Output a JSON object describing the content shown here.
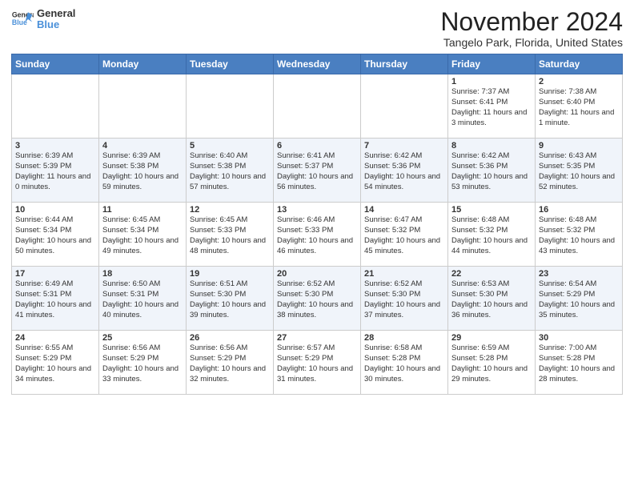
{
  "logo": {
    "line1": "General",
    "line2": "Blue"
  },
  "title": "November 2024",
  "subtitle": "Tangelo Park, Florida, United States",
  "days_of_week": [
    "Sunday",
    "Monday",
    "Tuesday",
    "Wednesday",
    "Thursday",
    "Friday",
    "Saturday"
  ],
  "weeks": [
    [
      {
        "day": "",
        "info": ""
      },
      {
        "day": "",
        "info": ""
      },
      {
        "day": "",
        "info": ""
      },
      {
        "day": "",
        "info": ""
      },
      {
        "day": "",
        "info": ""
      },
      {
        "day": "1",
        "info": "Sunrise: 7:37 AM\nSunset: 6:41 PM\nDaylight: 11 hours and 3 minutes."
      },
      {
        "day": "2",
        "info": "Sunrise: 7:38 AM\nSunset: 6:40 PM\nDaylight: 11 hours and 1 minute."
      }
    ],
    [
      {
        "day": "3",
        "info": "Sunrise: 6:39 AM\nSunset: 5:39 PM\nDaylight: 11 hours and 0 minutes."
      },
      {
        "day": "4",
        "info": "Sunrise: 6:39 AM\nSunset: 5:38 PM\nDaylight: 10 hours and 59 minutes."
      },
      {
        "day": "5",
        "info": "Sunrise: 6:40 AM\nSunset: 5:38 PM\nDaylight: 10 hours and 57 minutes."
      },
      {
        "day": "6",
        "info": "Sunrise: 6:41 AM\nSunset: 5:37 PM\nDaylight: 10 hours and 56 minutes."
      },
      {
        "day": "7",
        "info": "Sunrise: 6:42 AM\nSunset: 5:36 PM\nDaylight: 10 hours and 54 minutes."
      },
      {
        "day": "8",
        "info": "Sunrise: 6:42 AM\nSunset: 5:36 PM\nDaylight: 10 hours and 53 minutes."
      },
      {
        "day": "9",
        "info": "Sunrise: 6:43 AM\nSunset: 5:35 PM\nDaylight: 10 hours and 52 minutes."
      }
    ],
    [
      {
        "day": "10",
        "info": "Sunrise: 6:44 AM\nSunset: 5:34 PM\nDaylight: 10 hours and 50 minutes."
      },
      {
        "day": "11",
        "info": "Sunrise: 6:45 AM\nSunset: 5:34 PM\nDaylight: 10 hours and 49 minutes."
      },
      {
        "day": "12",
        "info": "Sunrise: 6:45 AM\nSunset: 5:33 PM\nDaylight: 10 hours and 48 minutes."
      },
      {
        "day": "13",
        "info": "Sunrise: 6:46 AM\nSunset: 5:33 PM\nDaylight: 10 hours and 46 minutes."
      },
      {
        "day": "14",
        "info": "Sunrise: 6:47 AM\nSunset: 5:32 PM\nDaylight: 10 hours and 45 minutes."
      },
      {
        "day": "15",
        "info": "Sunrise: 6:48 AM\nSunset: 5:32 PM\nDaylight: 10 hours and 44 minutes."
      },
      {
        "day": "16",
        "info": "Sunrise: 6:48 AM\nSunset: 5:32 PM\nDaylight: 10 hours and 43 minutes."
      }
    ],
    [
      {
        "day": "17",
        "info": "Sunrise: 6:49 AM\nSunset: 5:31 PM\nDaylight: 10 hours and 41 minutes."
      },
      {
        "day": "18",
        "info": "Sunrise: 6:50 AM\nSunset: 5:31 PM\nDaylight: 10 hours and 40 minutes."
      },
      {
        "day": "19",
        "info": "Sunrise: 6:51 AM\nSunset: 5:30 PM\nDaylight: 10 hours and 39 minutes."
      },
      {
        "day": "20",
        "info": "Sunrise: 6:52 AM\nSunset: 5:30 PM\nDaylight: 10 hours and 38 minutes."
      },
      {
        "day": "21",
        "info": "Sunrise: 6:52 AM\nSunset: 5:30 PM\nDaylight: 10 hours and 37 minutes."
      },
      {
        "day": "22",
        "info": "Sunrise: 6:53 AM\nSunset: 5:30 PM\nDaylight: 10 hours and 36 minutes."
      },
      {
        "day": "23",
        "info": "Sunrise: 6:54 AM\nSunset: 5:29 PM\nDaylight: 10 hours and 35 minutes."
      }
    ],
    [
      {
        "day": "24",
        "info": "Sunrise: 6:55 AM\nSunset: 5:29 PM\nDaylight: 10 hours and 34 minutes."
      },
      {
        "day": "25",
        "info": "Sunrise: 6:56 AM\nSunset: 5:29 PM\nDaylight: 10 hours and 33 minutes."
      },
      {
        "day": "26",
        "info": "Sunrise: 6:56 AM\nSunset: 5:29 PM\nDaylight: 10 hours and 32 minutes."
      },
      {
        "day": "27",
        "info": "Sunrise: 6:57 AM\nSunset: 5:29 PM\nDaylight: 10 hours and 31 minutes."
      },
      {
        "day": "28",
        "info": "Sunrise: 6:58 AM\nSunset: 5:28 PM\nDaylight: 10 hours and 30 minutes."
      },
      {
        "day": "29",
        "info": "Sunrise: 6:59 AM\nSunset: 5:28 PM\nDaylight: 10 hours and 29 minutes."
      },
      {
        "day": "30",
        "info": "Sunrise: 7:00 AM\nSunset: 5:28 PM\nDaylight: 10 hours and 28 minutes."
      }
    ]
  ]
}
